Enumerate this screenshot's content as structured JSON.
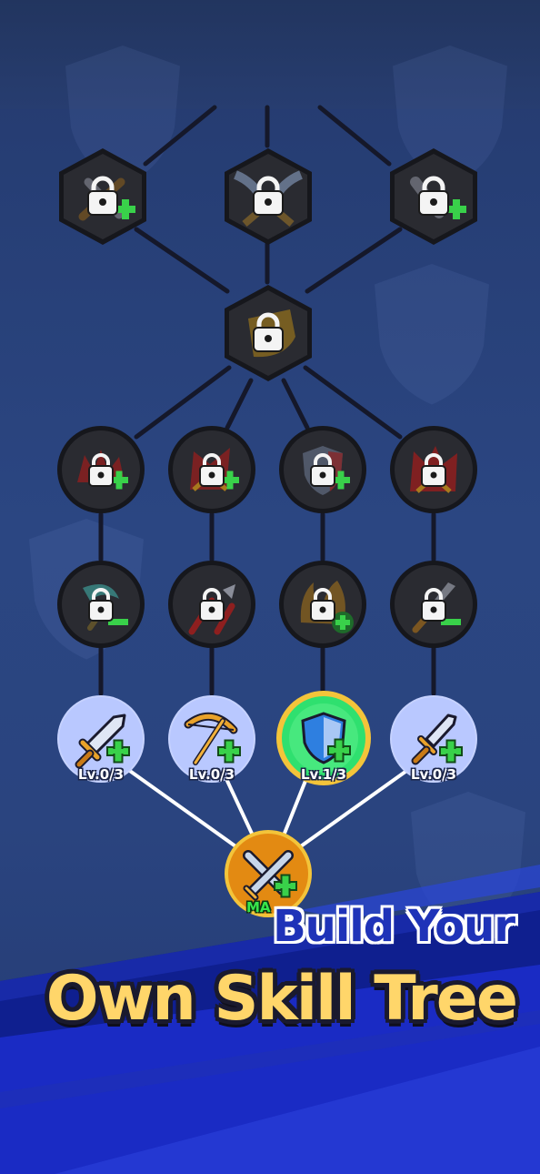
{
  "headline": {
    "line1": "Build Your",
    "line2": "Own Skill Tree"
  },
  "skill_tree": {
    "locked_hex_nodes": [
      {
        "name": "top-left-skill",
        "icon": "crossed-weapons-plus-icon",
        "locked": true
      },
      {
        "name": "top-middle-skill",
        "icon": "winged-sword-icon",
        "locked": true
      },
      {
        "name": "top-right-skill",
        "icon": "blade-plus-icon",
        "locked": true
      },
      {
        "name": "center-skill",
        "icon": "golden-shield-icon",
        "locked": true
      }
    ],
    "locked_circle_rows": [
      [
        {
          "icon": "red-flame-plus-icon",
          "locked": true
        },
        {
          "icon": "red-arrow-plus-icon",
          "locked": true
        },
        {
          "icon": "shield-plus-icon",
          "locked": true
        },
        {
          "icon": "red-spikes-icon",
          "locked": true
        }
      ],
      [
        {
          "icon": "scythe-minus-icon",
          "locked": true
        },
        {
          "icon": "double-arrow-icon",
          "locked": true
        },
        {
          "icon": "flame-plus-icon",
          "locked": true
        },
        {
          "icon": "dagger-minus-icon",
          "locked": true
        }
      ]
    ],
    "unlocked_nodes": [
      {
        "icon": "sword-plus-icon",
        "level": "Lv.0/3"
      },
      {
        "icon": "bow-plus-icon",
        "level": "Lv.0/3"
      },
      {
        "icon": "shield-plus-icon",
        "level": "Lv.1/3"
      },
      {
        "icon": "dagger-plus-icon",
        "level": "Lv.0/3"
      }
    ],
    "root_node": {
      "icon": "crossed-swords-plus-icon",
      "badge": "MA"
    }
  },
  "colors": {
    "background": "#2a447f",
    "locked_node": "#1e1f24",
    "unlocked_node": "#b9c8ff",
    "active_node": "#2fe06f",
    "active_ring": "#f3c43a",
    "root_node": "#e38a12",
    "plus_green": "#39d14a",
    "headline_blue": "#1f33b8",
    "headline_gold": "#ffd66a"
  }
}
